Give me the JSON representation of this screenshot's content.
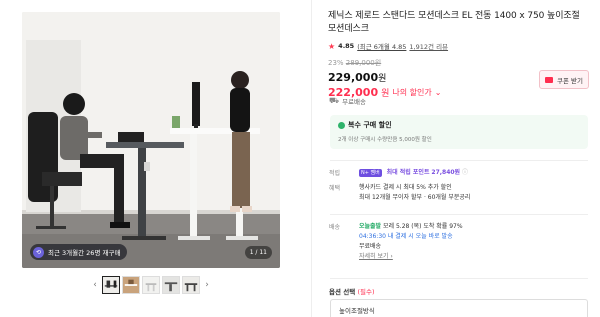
{
  "gallery": {
    "badge_text": "최근 3개월간 26명 재구매",
    "counter": "1 / 11",
    "prev_arrow": "‹",
    "next_arrow": "›",
    "thumb_count": 5
  },
  "product": {
    "title": "제닉스 제로드 스탠다드 모션데스크 EL 전동 1400 x 750 높이조절 모션데스크",
    "rating": "4.85",
    "rating_link": "(최근 6개월 4.85",
    "reviews": "1,912건 리뷰",
    "discount_pct": "23%",
    "original_price": "289,000원",
    "price": "229,000",
    "price_unit": "원",
    "my_price": "222,000",
    "my_price_unit": "원",
    "my_price_label": "나의 할인가",
    "my_price_chevron": "⌄",
    "coupon_label": "쿠폰 받기",
    "shipping": "무료배송"
  },
  "promo": {
    "title": "복수 구매 할인",
    "desc": "2개 이상 구매시 수량만큼 5,000원 할인"
  },
  "details": {
    "points_key": "적립",
    "points_badge": "N+ 멤버",
    "points_text": "최대 적립 포인트",
    "points_value": "27,840원",
    "benefit_key": "혜택",
    "benefit_line1": "행사카드 결제 시 최대 5% 추가 할인",
    "benefit_line2": "최대 12개월 무이자 할부 · 60개월 부분공리",
    "delivery_key": "배송",
    "delivery_today": "오늘출발",
    "delivery_line1": "모레 5.28 (목) 도착 확률 97%",
    "delivery_line2": "04:36:30 내 결제 시 오늘 바로 발송",
    "delivery_line3": "무료배송",
    "more_link": "자세히 보기 ›"
  },
  "options": {
    "label": "옵션 선택",
    "required": "(필수)",
    "selected": "높이조절방식"
  }
}
